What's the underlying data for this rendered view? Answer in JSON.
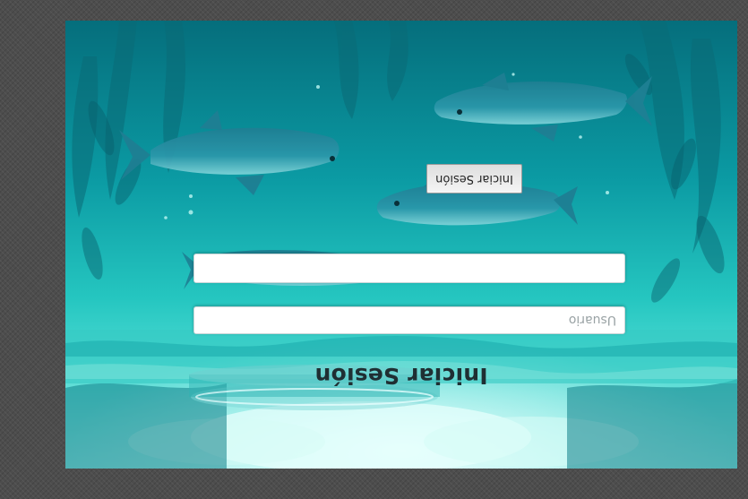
{
  "login": {
    "title": "Iniciar Sesión",
    "username": {
      "placeholder": "Usuario",
      "value": ""
    },
    "password": {
      "placeholder": "",
      "value": ""
    },
    "submit_label": "Iniciar Sesión"
  },
  "colors": {
    "water": "#1fb7b2",
    "deep_water": "#066a78",
    "fish": "#2a8fa2",
    "page_background": "#4d4d4d"
  },
  "orientation": "rotated 180 degrees"
}
